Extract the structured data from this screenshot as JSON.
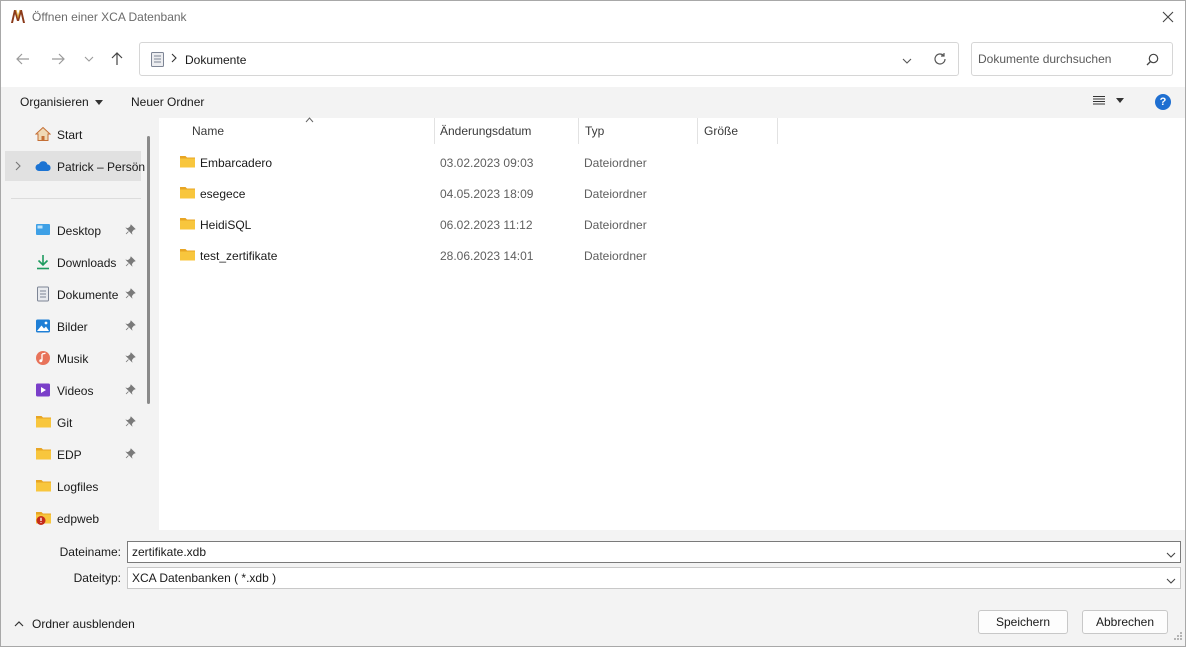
{
  "window": {
    "title": "Öffnen einer XCA Datenbank"
  },
  "nav": {
    "address_path": "Dokumente",
    "search_placeholder": "Dokumente durchsuchen"
  },
  "commands": {
    "organize_label": "Organisieren",
    "new_folder_label": "Neuer Ordner"
  },
  "sidebar": {
    "items": [
      {
        "label": "Start",
        "icon": "home-icon"
      },
      {
        "label": "Patrick – Persön",
        "icon": "onedrive-cloud-icon"
      },
      {
        "label": "Desktop",
        "icon": "desktop-icon"
      },
      {
        "label": "Downloads",
        "icon": "download-icon"
      },
      {
        "label": "Dokumente",
        "icon": "document-icon"
      },
      {
        "label": "Bilder",
        "icon": "pictures-icon"
      },
      {
        "label": "Musik",
        "icon": "music-icon"
      },
      {
        "label": "Videos",
        "icon": "videos-icon"
      },
      {
        "label": "Git",
        "icon": "folder-icon"
      },
      {
        "label": "EDP",
        "icon": "folder-icon"
      },
      {
        "label": "Logfiles",
        "icon": "folder-icon"
      },
      {
        "label": "edpweb",
        "icon": "folder-warning-icon"
      }
    ]
  },
  "table": {
    "columns": [
      "Name",
      "Änderungsdatum",
      "Typ",
      "Größe"
    ],
    "rows": [
      {
        "name": "Embarcadero",
        "date": "03.02.2023 09:03",
        "type": "Dateiordner"
      },
      {
        "name": "esegece",
        "date": "04.05.2023 18:09",
        "type": "Dateiordner"
      },
      {
        "name": "HeidiSQL",
        "date": "06.02.2023 11:12",
        "type": "Dateiordner"
      },
      {
        "name": "test_zertifikate",
        "date": "28.06.2023 14:01",
        "type": "Dateiordner"
      }
    ]
  },
  "footer": {
    "filename_label": "Dateiname:",
    "filename_value": "zertifikate.xdb",
    "filetype_label": "Dateityp:",
    "filetype_value": "XCA Datenbanken ( *.xdb )",
    "hide_folders_label": "Ordner ausblenden",
    "save_label": "Speichern",
    "cancel_label": "Abbrechen"
  },
  "colors": {
    "folder": "#f8c63d",
    "accent": "#1f6fd1",
    "panel_bg": "#f3f3f3"
  }
}
